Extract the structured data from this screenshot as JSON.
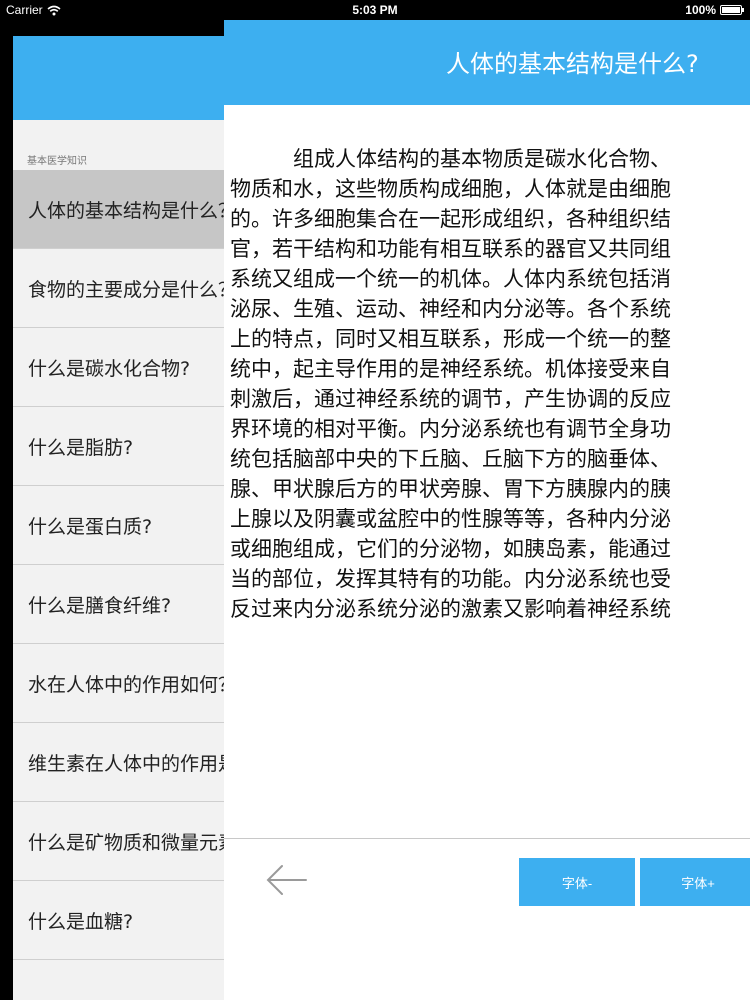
{
  "status_bar": {
    "carrier": "Carrier",
    "time": "5:03 PM",
    "battery": "100%",
    "battery_level": 1.0
  },
  "master": {
    "section_header": "基本医学知识",
    "items": [
      {
        "label": "人体的基本结构是什么？",
        "selected": true
      },
      {
        "label": "食物的主要成分是什么？"
      },
      {
        "label": "什么是碳水化合物?"
      },
      {
        "label": "什么是脂肪?"
      },
      {
        "label": "什么是蛋白质?"
      },
      {
        "label": "什么是膳食纤维?"
      },
      {
        "label": "水在人体中的作用如何？"
      },
      {
        "label": "维生素在人体中的作用是什么？"
      },
      {
        "label": "什么是矿物质和微量元素？"
      },
      {
        "label": "什么是血糖?"
      }
    ]
  },
  "detail": {
    "title": "人体的基本结构是什么?",
    "content": "　　　组成人体结构的基本物质是碳水化合物、\n物质和水，这些物质构成细胞，人体就是由细胞\n的。许多细胞集合在一起形成组织，各种组织结\n官，若干结构和功能有相互联系的器官又共同组\n系统又组成一个统一的机体。人体内系统包括消\n泌尿、生殖、运动、神经和内分泌等。各个系统\n上的特点，同时又相互联系，形成一个统一的整\n统中，起主导作用的是神经系统。机体接受来自\n刺激后，通过神经系统的调节，产生协调的反应\n界环境的相对平衡。内分泌系统也有调节全身功\n统包括脑部中央的下丘脑、丘脑下方的脑垂体、\n腺、甲状腺后方的甲状旁腺、胃下方胰腺内的胰\n上腺以及阴囊或盆腔中的性腺等等，各种内分泌\n或细胞组成，它们的分泌物，如胰岛素，能通过\n当的部位，发挥其特有的功能。内分泌系统也受\n反过来内分泌系统分泌的激素又影响着神经系统",
    "font_minus_label": "字体-",
    "font_plus_label": "字体+",
    "back_icon": "arrow-left-icon"
  },
  "colors": {
    "accent": "#3daff0",
    "master_bg": "#f2f2f2",
    "selected_row": "#c6c6c6"
  }
}
